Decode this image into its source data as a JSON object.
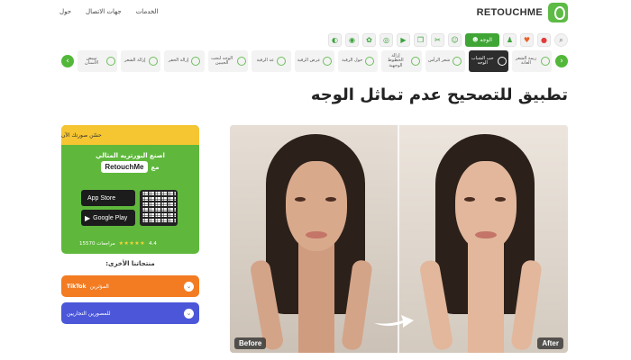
{
  "header": {
    "nav": [
      "حول",
      "جهات الاتصال",
      "الخدمات"
    ],
    "brand": "RETOUCHME"
  },
  "toolbar": {
    "home_label": "الوجه",
    "icons": [
      "search-icon",
      "coin-icon",
      "heart-icon",
      "user-icon",
      "face-icon",
      "brush-icon",
      "layers-icon",
      "video-icon",
      "palette-icon",
      "tone-icon",
      "camera-icon"
    ]
  },
  "categories": [
    "ريمة الشعر العانة",
    "حب الشباب الوجه",
    "شعر الرأس",
    "إزالة الخطوط الوجهية",
    "حول الرقبة",
    "عرض الرقبة",
    "عد الرقبة",
    "الوجه لنحت الجيبين",
    "إزالة الحفر",
    "إزالة الشعر",
    "تبييض الأسنان"
  ],
  "page": {
    "title": "تطبيق للتصحيح عدم تماثل الوجه"
  },
  "promo": {
    "top_text": "حسّن صورتك الآن",
    "line1": "اصنع البورتريه المثالي",
    "line2_prefix": "مع",
    "brand_chip": "RetouchMe",
    "app_store": "App Store",
    "google_play": "Google Play",
    "rating": "4.4",
    "reviews": "15570 مراجعات",
    "stars": "★★★★★"
  },
  "others": {
    "title": "منتجاتنا الأخرى:",
    "tiktok_name": "TikTok",
    "tiktok_sub": "المؤثرين",
    "biz_sub": "للمصورين التجاريين"
  },
  "image": {
    "before": "Before",
    "after": "After"
  },
  "colors": {
    "brand_green": "#5fb83c",
    "promo_yellow": "#f6c532",
    "tiktok_orange": "#f37b21",
    "biz_blue": "#4b57d8"
  }
}
